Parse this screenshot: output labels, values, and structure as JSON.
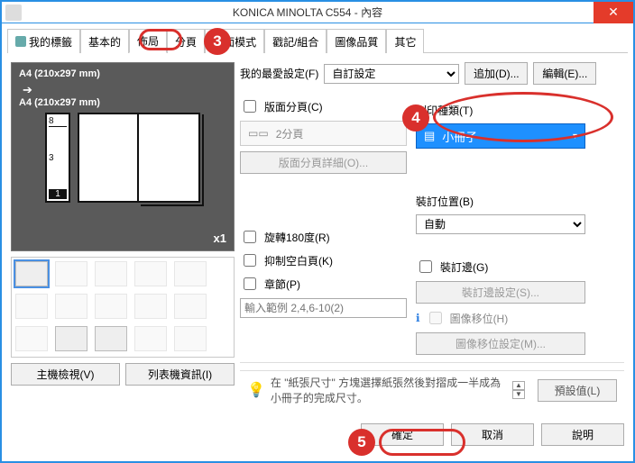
{
  "window": {
    "title": "KONICA MINOLTA C554 - 內容"
  },
  "tabs": [
    {
      "label": "我的標籤"
    },
    {
      "label": "基本的"
    },
    {
      "label": "佈局"
    },
    {
      "label": "分頁"
    },
    {
      "label": "封面模式"
    },
    {
      "label": "戳記/組合"
    },
    {
      "label": "圖像品質"
    },
    {
      "label": "其它"
    }
  ],
  "preview": {
    "from": "A4 (210x297 mm)",
    "to": "A4 (210x297 mm)",
    "copies": "x1",
    "shelf": {
      "upper": "8",
      "lower": "3",
      "eject": "1"
    }
  },
  "bottom_left": {
    "host_view": "主機檢視(V)",
    "printer_info": "列表機資訊(I)"
  },
  "favorites": {
    "label": "我的最愛設定(F)",
    "value": "自訂設定",
    "add": "追加(D)...",
    "edit": "編輯(E)..."
  },
  "layout": {
    "imposition": {
      "label": "版面分頁(C)",
      "chip": "2分頁",
      "detail": "版面分頁詳細(O)..."
    },
    "rotate": "旋轉180度(R)",
    "suppress_blank": "抑制空白頁(K)",
    "chapter": {
      "label": "章節(P)",
      "example": "輸入範例 2,4,6-10(2)"
    }
  },
  "print_type": {
    "label": "列印種類(T)",
    "value": "小冊子"
  },
  "binding": {
    "label": "裝訂位置(B)",
    "value": "自動",
    "staple": {
      "label": "裝訂邊(G)",
      "settings": "裝訂邊設定(S)..."
    },
    "shift": {
      "label": "圖像移位(H)",
      "settings": "圖像移位設定(M)..."
    }
  },
  "hint": {
    "text": "在 \"紙張尺寸\" 方塊選擇紙張然後對摺成一半成為小冊子的完成尺寸。",
    "defaults": "預設值(L)"
  },
  "footer": {
    "ok": "確定",
    "cancel": "取消",
    "help": "說明"
  },
  "callouts": {
    "c3": "3",
    "c4": "4",
    "c5": "5"
  }
}
